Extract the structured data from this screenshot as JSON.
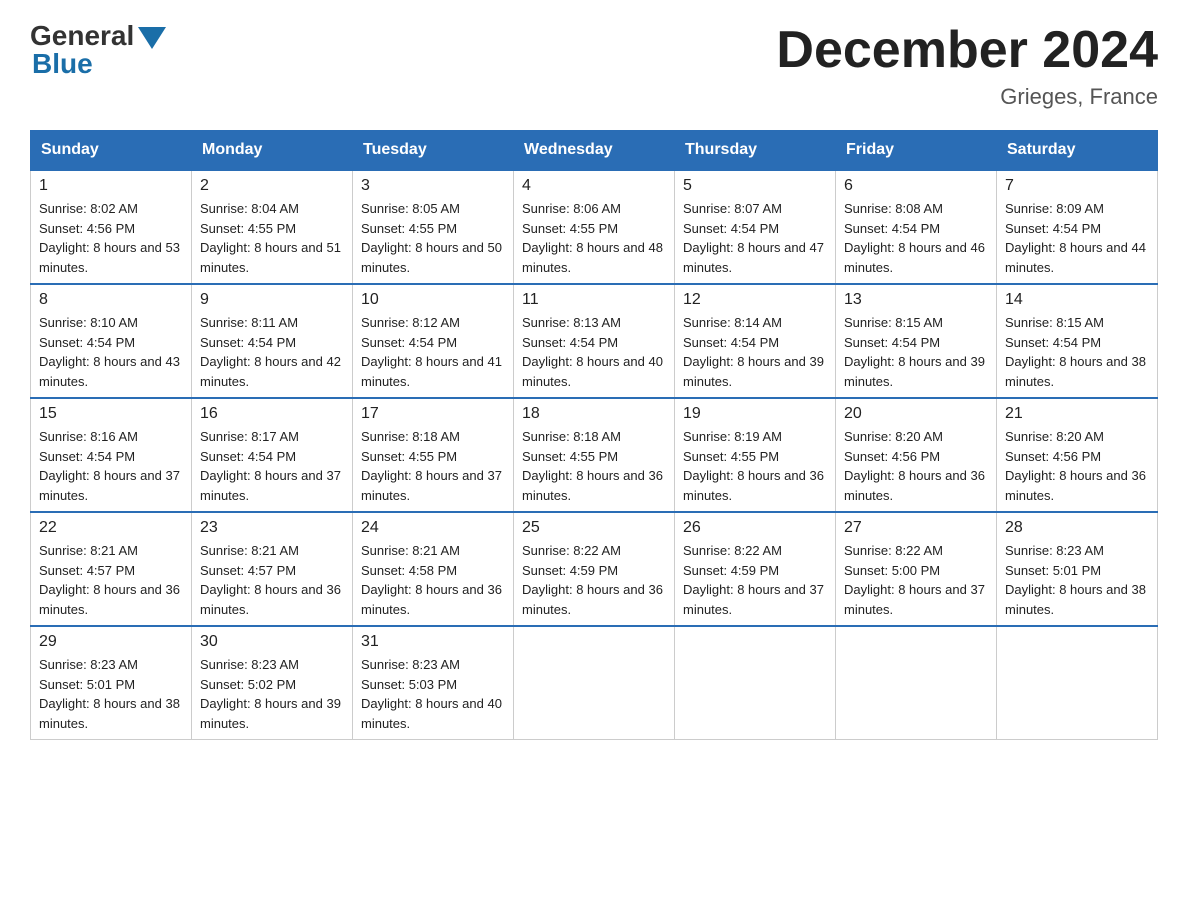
{
  "header": {
    "logo_general": "General",
    "logo_blue": "Blue",
    "month_title": "December 2024",
    "location": "Grieges, France"
  },
  "weekdays": [
    "Sunday",
    "Monday",
    "Tuesday",
    "Wednesday",
    "Thursday",
    "Friday",
    "Saturday"
  ],
  "weeks": [
    [
      {
        "day": "1",
        "sunrise": "8:02 AM",
        "sunset": "4:56 PM",
        "daylight": "8 hours and 53 minutes."
      },
      {
        "day": "2",
        "sunrise": "8:04 AM",
        "sunset": "4:55 PM",
        "daylight": "8 hours and 51 minutes."
      },
      {
        "day": "3",
        "sunrise": "8:05 AM",
        "sunset": "4:55 PM",
        "daylight": "8 hours and 50 minutes."
      },
      {
        "day": "4",
        "sunrise": "8:06 AM",
        "sunset": "4:55 PM",
        "daylight": "8 hours and 48 minutes."
      },
      {
        "day": "5",
        "sunrise": "8:07 AM",
        "sunset": "4:54 PM",
        "daylight": "8 hours and 47 minutes."
      },
      {
        "day": "6",
        "sunrise": "8:08 AM",
        "sunset": "4:54 PM",
        "daylight": "8 hours and 46 minutes."
      },
      {
        "day": "7",
        "sunrise": "8:09 AM",
        "sunset": "4:54 PM",
        "daylight": "8 hours and 44 minutes."
      }
    ],
    [
      {
        "day": "8",
        "sunrise": "8:10 AM",
        "sunset": "4:54 PM",
        "daylight": "8 hours and 43 minutes."
      },
      {
        "day": "9",
        "sunrise": "8:11 AM",
        "sunset": "4:54 PM",
        "daylight": "8 hours and 42 minutes."
      },
      {
        "day": "10",
        "sunrise": "8:12 AM",
        "sunset": "4:54 PM",
        "daylight": "8 hours and 41 minutes."
      },
      {
        "day": "11",
        "sunrise": "8:13 AM",
        "sunset": "4:54 PM",
        "daylight": "8 hours and 40 minutes."
      },
      {
        "day": "12",
        "sunrise": "8:14 AM",
        "sunset": "4:54 PM",
        "daylight": "8 hours and 39 minutes."
      },
      {
        "day": "13",
        "sunrise": "8:15 AM",
        "sunset": "4:54 PM",
        "daylight": "8 hours and 39 minutes."
      },
      {
        "day": "14",
        "sunrise": "8:15 AM",
        "sunset": "4:54 PM",
        "daylight": "8 hours and 38 minutes."
      }
    ],
    [
      {
        "day": "15",
        "sunrise": "8:16 AM",
        "sunset": "4:54 PM",
        "daylight": "8 hours and 37 minutes."
      },
      {
        "day": "16",
        "sunrise": "8:17 AM",
        "sunset": "4:54 PM",
        "daylight": "8 hours and 37 minutes."
      },
      {
        "day": "17",
        "sunrise": "8:18 AM",
        "sunset": "4:55 PM",
        "daylight": "8 hours and 37 minutes."
      },
      {
        "day": "18",
        "sunrise": "8:18 AM",
        "sunset": "4:55 PM",
        "daylight": "8 hours and 36 minutes."
      },
      {
        "day": "19",
        "sunrise": "8:19 AM",
        "sunset": "4:55 PM",
        "daylight": "8 hours and 36 minutes."
      },
      {
        "day": "20",
        "sunrise": "8:20 AM",
        "sunset": "4:56 PM",
        "daylight": "8 hours and 36 minutes."
      },
      {
        "day": "21",
        "sunrise": "8:20 AM",
        "sunset": "4:56 PM",
        "daylight": "8 hours and 36 minutes."
      }
    ],
    [
      {
        "day": "22",
        "sunrise": "8:21 AM",
        "sunset": "4:57 PM",
        "daylight": "8 hours and 36 minutes."
      },
      {
        "day": "23",
        "sunrise": "8:21 AM",
        "sunset": "4:57 PM",
        "daylight": "8 hours and 36 minutes."
      },
      {
        "day": "24",
        "sunrise": "8:21 AM",
        "sunset": "4:58 PM",
        "daylight": "8 hours and 36 minutes."
      },
      {
        "day": "25",
        "sunrise": "8:22 AM",
        "sunset": "4:59 PM",
        "daylight": "8 hours and 36 minutes."
      },
      {
        "day": "26",
        "sunrise": "8:22 AM",
        "sunset": "4:59 PM",
        "daylight": "8 hours and 37 minutes."
      },
      {
        "day": "27",
        "sunrise": "8:22 AM",
        "sunset": "5:00 PM",
        "daylight": "8 hours and 37 minutes."
      },
      {
        "day": "28",
        "sunrise": "8:23 AM",
        "sunset": "5:01 PM",
        "daylight": "8 hours and 38 minutes."
      }
    ],
    [
      {
        "day": "29",
        "sunrise": "8:23 AM",
        "sunset": "5:01 PM",
        "daylight": "8 hours and 38 minutes."
      },
      {
        "day": "30",
        "sunrise": "8:23 AM",
        "sunset": "5:02 PM",
        "daylight": "8 hours and 39 minutes."
      },
      {
        "day": "31",
        "sunrise": "8:23 AM",
        "sunset": "5:03 PM",
        "daylight": "8 hours and 40 minutes."
      },
      null,
      null,
      null,
      null
    ]
  ]
}
